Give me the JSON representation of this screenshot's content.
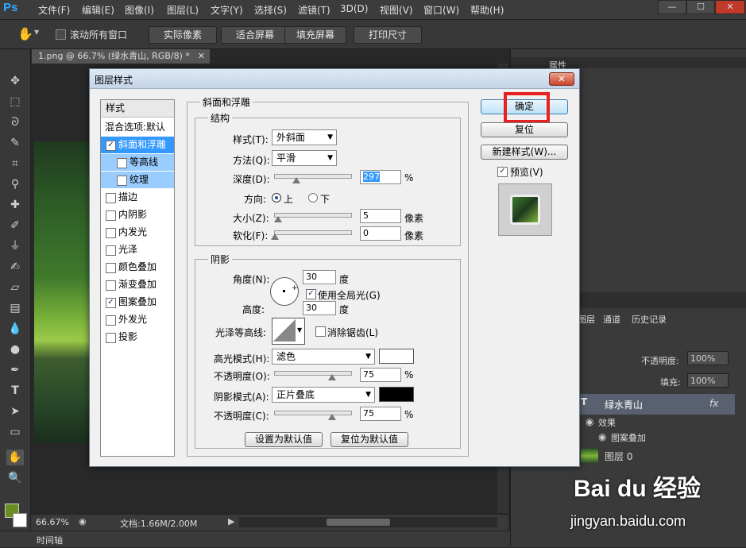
{
  "app": {
    "logo": "Ps"
  },
  "menu": [
    "文件(F)",
    "编辑(E)",
    "图像(I)",
    "图层(L)",
    "文字(Y)",
    "选择(S)",
    "滤镜(T)",
    "3D(D)",
    "视图(V)",
    "窗口(W)",
    "帮助(H)"
  ],
  "window_controls": {
    "minimize": "—",
    "maximize": "☐",
    "close": "✕"
  },
  "options_bar": {
    "scroll_all_label": "滚动所有窗口",
    "buttons": [
      "实际像素",
      "适合屏幕",
      "填充屏幕",
      "打印尺寸"
    ]
  },
  "document": {
    "tab_title": "1.png @ 66.7% (绿水青山, RGB/8) *",
    "zoom": "66.67%",
    "doc_info": "文档:1.66M/2.00M"
  },
  "timeline": {
    "label": "时间轴"
  },
  "right_panels": {
    "properties_tab": "属性",
    "layer_tabs": [
      "图层",
      "通道",
      "历史记录"
    ],
    "opacity_label": "不透明度:",
    "opacity_value": "100%",
    "fill_label": "填充:",
    "fill_value": "100%",
    "layers": [
      {
        "name": "绿水青山",
        "fx": "fx"
      },
      {
        "name": "效果"
      },
      {
        "name": "图案叠加"
      },
      {
        "name": "图层 0"
      }
    ]
  },
  "dialog": {
    "title": "图层样式",
    "close": "✕",
    "styles_header": "样式",
    "blend_options": "混合选项:默认",
    "style_items": [
      {
        "label": "斜面和浮雕",
        "checked": true
      },
      {
        "label": "等高线",
        "checked": false
      },
      {
        "label": "纹理",
        "checked": false
      },
      {
        "label": "描边",
        "checked": false
      },
      {
        "label": "内阴影",
        "checked": false
      },
      {
        "label": "内发光",
        "checked": false
      },
      {
        "label": "光泽",
        "checked": false
      },
      {
        "label": "颜色叠加",
        "checked": false
      },
      {
        "label": "渐变叠加",
        "checked": false
      },
      {
        "label": "图案叠加",
        "checked": true
      },
      {
        "label": "外发光",
        "checked": false
      },
      {
        "label": "投影",
        "checked": false
      }
    ],
    "bevel": {
      "section_title": "斜面和浮雕",
      "structure_title": "结构",
      "style_label": "样式(T):",
      "style_value": "外斜面",
      "technique_label": "方法(Q):",
      "technique_value": "平滑",
      "depth_label": "深度(D):",
      "depth_value": "297",
      "depth_unit": "%",
      "direction_label": "方向:",
      "direction_up": "上",
      "direction_down": "下",
      "size_label": "大小(Z):",
      "size_value": "5",
      "size_unit": "像素",
      "soften_label": "软化(F):",
      "soften_value": "0",
      "soften_unit": "像素"
    },
    "shading": {
      "title": "阴影",
      "angle_label": "角度(N):",
      "angle_value": "30",
      "angle_unit": "度",
      "global_light_label": "使用全局光(G)",
      "altitude_label": "高度:",
      "altitude_value": "30",
      "altitude_unit": "度",
      "gloss_label": "光泽等高线:",
      "antialias_label": "消除锯齿(L)",
      "highlight_mode_label": "高光模式(H):",
      "highlight_mode_value": "滤色",
      "highlight_opacity_label": "不透明度(O):",
      "highlight_opacity_value": "75",
      "shadow_mode_label": "阴影模式(A):",
      "shadow_mode_value": "正片叠底",
      "shadow_opacity_label": "不透明度(C):",
      "shadow_opacity_value": "75",
      "percent": "%",
      "highlight_color": "#ffffff",
      "shadow_color": "#000000"
    },
    "set_default": "设置为默认值",
    "reset_default": "复位为默认值",
    "ok": "确定",
    "reset": "复位",
    "new_style": "新建样式(W)...",
    "preview_label": "预览(V)"
  },
  "watermark": {
    "brand": "Bai du 经验",
    "url": "jingyan.baidu.com"
  },
  "colors": {
    "highlight_box": "#e8201e",
    "selection": "#3399ff",
    "accent": "#31a8ff"
  }
}
